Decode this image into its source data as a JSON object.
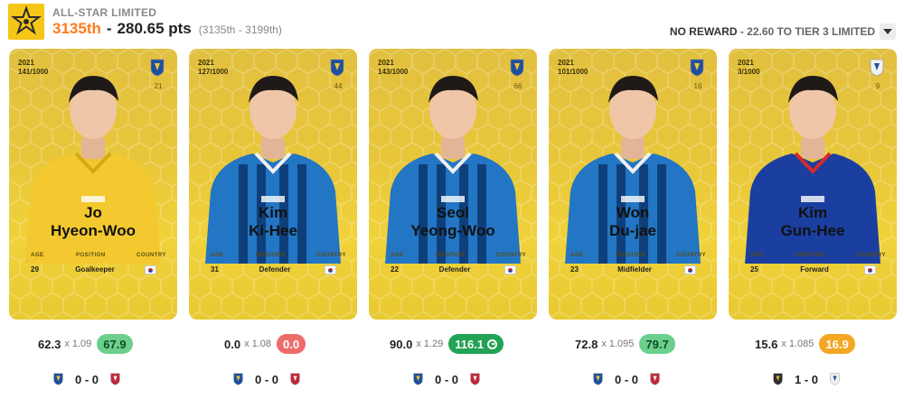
{
  "header": {
    "league": "ALL-STAR LIMITED",
    "rank": "3135th",
    "separator": "-",
    "points": "280.65 pts",
    "range": "(3135th - 3199th)",
    "reward_label": "NO REWARD",
    "reward_rest": " - 22.60 TO TIER 3 LIMITED"
  },
  "colors": {
    "accent_orange": "#ff7a1a",
    "card_gold": "#e8c63a",
    "pill_green": "#6ccf8e",
    "pill_red": "#ef6b6b",
    "pill_darkgreen": "#22a355",
    "pill_orange": "#f5a623"
  },
  "stat_labels": {
    "age": "AGE",
    "position": "POSITION",
    "country": "COUNTRY"
  },
  "cards": [
    {
      "year": "2021",
      "serial": "141/1000",
      "club_number": "21",
      "name_line1": "Jo",
      "name_line2": "Hyeon-Woo",
      "age": "29",
      "position": "Goalkeeper",
      "country_flag": "south-korea-flag",
      "kit": "yellow",
      "club_badge": "ulsan-badge",
      "base": "62.3",
      "mult": "x 1.09",
      "score": "67.9",
      "score_color": "green",
      "score_icon": "",
      "home_icon": "ulsan-badge",
      "match_score": "0 - 0",
      "away_icon": "red-club-badge"
    },
    {
      "year": "2021",
      "serial": "127/1000",
      "club_number": "44",
      "name_line1": "Kim",
      "name_line2": "Ki-Hee",
      "age": "31",
      "position": "Defender",
      "country_flag": "south-korea-flag",
      "kit": "blue-stripe",
      "club_badge": "ulsan-badge",
      "base": "0.0",
      "mult": "x 1.08",
      "score": "0.0",
      "score_color": "red",
      "score_icon": "",
      "home_icon": "ulsan-badge",
      "match_score": "0 - 0",
      "away_icon": "red-club-badge"
    },
    {
      "year": "2021",
      "serial": "143/1000",
      "club_number": "66",
      "name_line1": "Seol",
      "name_line2": "Yeong-Woo",
      "age": "22",
      "position": "Defender",
      "country_flag": "south-korea-flag",
      "kit": "blue-stripe",
      "club_badge": "ulsan-badge",
      "base": "90.0",
      "mult": "x 1.29",
      "score": "116.1",
      "score_color": "darkgreen",
      "score_icon": "goal-icon",
      "home_icon": "ulsan-badge",
      "match_score": "0 - 0",
      "away_icon": "red-club-badge"
    },
    {
      "year": "2021",
      "serial": "101/1000",
      "club_number": "16",
      "name_line1": "Won",
      "name_line2": "Du-jae",
      "age": "23",
      "position": "Midfielder",
      "country_flag": "south-korea-flag",
      "kit": "blue-stripe",
      "club_badge": "ulsan-badge",
      "base": "72.8",
      "mult": "x 1.095",
      "score": "79.7",
      "score_color": "green",
      "score_icon": "",
      "home_icon": "ulsan-badge",
      "match_score": "0 - 0",
      "away_icon": "red-club-badge"
    },
    {
      "year": "2021",
      "serial": "3/1000",
      "club_number": "9",
      "name_line1": "Kim",
      "name_line2": "Gun-Hee",
      "age": "25",
      "position": "Forward",
      "country_flag": "south-korea-flag",
      "kit": "blue-samsung",
      "club_badge": "suwon-badge",
      "base": "15.6",
      "mult": "x 1.085",
      "score": "16.9",
      "score_color": "orange",
      "score_icon": "",
      "home_icon": "dark-club-badge",
      "match_score": "1 - 0",
      "away_icon": "suwon-badge"
    }
  ]
}
